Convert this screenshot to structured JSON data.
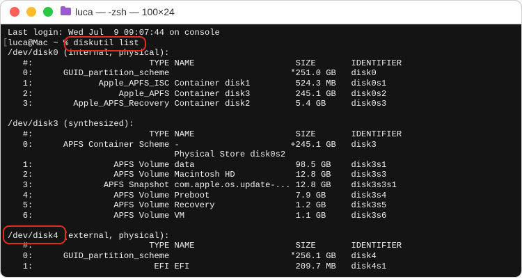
{
  "window": {
    "title": "luca — -zsh — 100×24"
  },
  "terminal": {
    "lines": [
      "Last login: Wed Jul  9 09:07:44 on console",
      "luca@Mac ~ % diskutil list",
      "/dev/disk0 (internal, physical):",
      "   #:                       TYPE NAME                    SIZE       IDENTIFIER",
      "   0:      GUID_partition_scheme                        *251.0 GB   disk0",
      "   1:             Apple_APFS_ISC Container disk1         524.3 MB   disk0s1",
      "   2:                 Apple_APFS Container disk3         245.1 GB   disk0s2",
      "   3:        Apple_APFS_Recovery Container disk2         5.4 GB     disk0s3",
      "",
      "/dev/disk3 (synthesized):",
      "   #:                       TYPE NAME                    SIZE       IDENTIFIER",
      "   0:      APFS Container Scheme -                      +245.1 GB   disk3",
      "                                 Physical Store disk0s2",
      "   1:                APFS Volume data                    98.5 GB    disk3s1",
      "   2:                APFS Volume Macintosh HD            12.8 GB    disk3s3",
      "   3:              APFS Snapshot com.apple.os.update-... 12.8 GB    disk3s3s1",
      "   4:                APFS Volume Preboot                 7.9 GB     disk3s4",
      "   5:                APFS Volume Recovery                1.2 GB     disk3s5",
      "   6:                APFS Volume VM                      1.1 GB     disk3s6",
      "",
      "/dev/disk4 (external, physical):",
      "   #:                       TYPE NAME                    SIZE       IDENTIFIER",
      "   0:      GUID_partition_scheme                        *256.1 GB   disk4",
      "   1:                        EFI EFI                     209.7 MB   disk4s1"
    ],
    "mark": "["
  },
  "colors": {
    "highlight": "#e8291c"
  }
}
